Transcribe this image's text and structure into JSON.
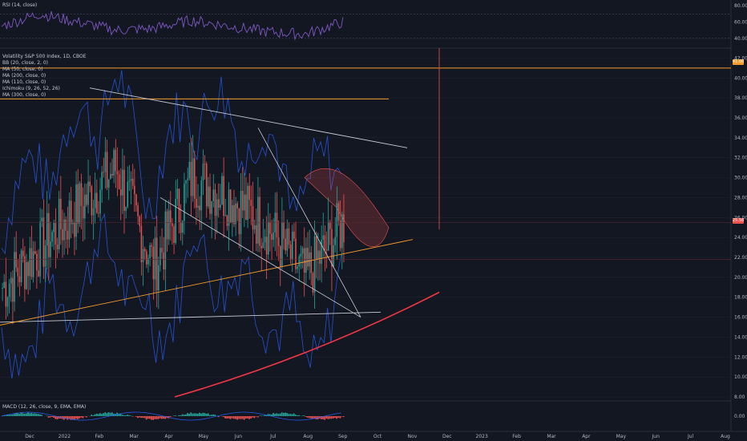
{
  "panels": {
    "rsi": {
      "legend": "RSI (14, close)",
      "y_ticks": [
        "80.00",
        "60.00",
        "40.00"
      ]
    },
    "main": {
      "legend": [
        "Volatility S&P 500 Index, 1D, CBOE",
        "BB (20, close, 2, 0)",
        "MA (50, close, 0)",
        "MA (200, close, 0)",
        "MA (110, close, 0)",
        "Ichimoku (9, 26, 52, 26)",
        "MA (300, close, 0)"
      ],
      "y_ticks": [
        "42.00",
        "40.00",
        "38.00",
        "36.00",
        "34.00",
        "32.00",
        "30.00",
        "28.00",
        "26.00",
        "24.00",
        "22.00",
        "20.00",
        "18.00",
        "16.00",
        "14.00",
        "12.00",
        "10.00",
        "8.00"
      ],
      "price_badge": "25.56",
      "orange_badge": "41.00"
    },
    "macd": {
      "legend": "MACD (12, 26, close, 9, EMA, EMA)",
      "y_ticks": [
        "0.00"
      ]
    }
  },
  "x_axis": {
    "labels": [
      "Dec",
      "2022",
      "Feb",
      "Mar",
      "Apr",
      "May",
      "Jun",
      "Jul",
      "Aug",
      "Sep",
      "Oct",
      "Nov",
      "Dec",
      "2023",
      "Feb",
      "Mar",
      "Apr",
      "May",
      "Jun",
      "Jul",
      "Aug"
    ]
  },
  "colors": {
    "background": "#131722",
    "up": "#26a69a",
    "down": "#ef5350",
    "orange_line": "#f59b2a",
    "trend_line": "#c8cbd2",
    "red_curve": "#f23645",
    "bb_band": "#2962ff",
    "rsi_line": "#7e57c2"
  },
  "chart_data": {
    "type": "candlestick",
    "title": "Volatility S&P 500 Index, 1D, CBOE",
    "price_axis_range": [
      8,
      43
    ],
    "rsi_axis_range": [
      30,
      85
    ],
    "last_price": 25.56,
    "horizontal_levels": [
      41.0,
      37.9
    ],
    "vix_path": {
      "months": [
        "Dec",
        "2022",
        "Feb",
        "Mar",
        "Apr",
        "May",
        "Jun",
        "Jul",
        "Aug",
        "Sep"
      ],
      "approx_close": [
        19,
        23,
        27,
        31,
        21,
        30,
        28,
        25,
        20,
        25.5
      ]
    },
    "rsi_path": [
      55,
      70,
      60,
      50,
      52,
      62,
      55,
      48,
      45,
      60
    ]
  }
}
